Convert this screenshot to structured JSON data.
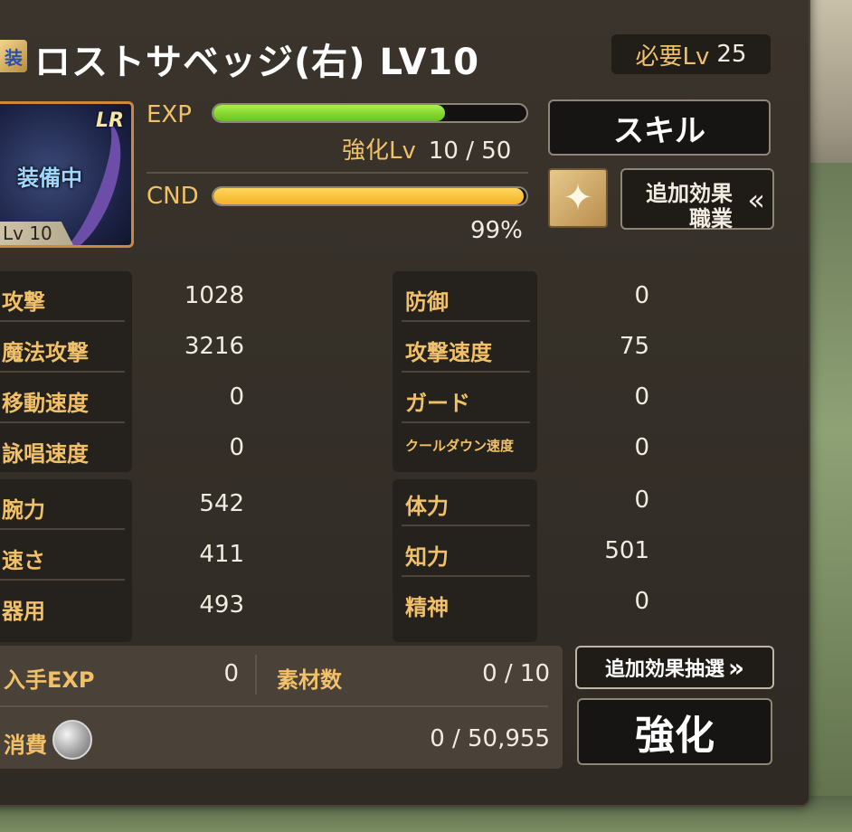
{
  "item": {
    "badge": "装",
    "name": "ロストサベッジ(右) LV10",
    "required_label": "必要Lv",
    "required_value": "25",
    "rarity": "LR",
    "equipped_label": "装備中",
    "level_tag": "Lv 10"
  },
  "exp": {
    "label": "EXP",
    "fill_fraction": 0.74,
    "enhance_label": "強化Lv",
    "enhance_value": "10 / 50"
  },
  "cnd": {
    "label": "CND",
    "fill_fraction": 0.99,
    "percent_text": "99%"
  },
  "buttons": {
    "skill": "スキル",
    "extra_effect_line1": "追加効果",
    "extra_effect_line2": "職業",
    "extra_effect_chevron": "«",
    "lottery": "追加効果抽選",
    "lottery_chevron": "»",
    "enhance": "強化"
  },
  "stats_left_top": [
    {
      "name": "攻撃",
      "value": "1028"
    },
    {
      "name": "魔法攻撃",
      "value": "3216"
    },
    {
      "name": "移動速度",
      "value": "0"
    },
    {
      "name": "詠唱速度",
      "value": "0"
    }
  ],
  "stats_right_top": [
    {
      "name": "防御",
      "value": "0"
    },
    {
      "name": "攻撃速度",
      "value": "75"
    },
    {
      "name": "ガード",
      "value": "0"
    },
    {
      "name": "クールダウン速度",
      "value": "0"
    }
  ],
  "stats_left_bottom": [
    {
      "name": "腕力",
      "value": "542"
    },
    {
      "name": "速さ",
      "value": "411"
    },
    {
      "name": "器用",
      "value": "493"
    }
  ],
  "stats_right_bottom": [
    {
      "name": "体力",
      "value": "0"
    },
    {
      "name": "知力",
      "value": "501"
    },
    {
      "name": "精神",
      "value": "0"
    }
  ],
  "enhance_info": {
    "gain_exp_label": "入手EXP",
    "gain_exp_value": "0",
    "materials_label": "素材数",
    "materials_value": "0 / 10",
    "cost_label": "消費",
    "cost_value": "0 / 50,955"
  },
  "icons": {
    "job": "sparkle-star-icon",
    "coin": "silver-coin-icon"
  }
}
